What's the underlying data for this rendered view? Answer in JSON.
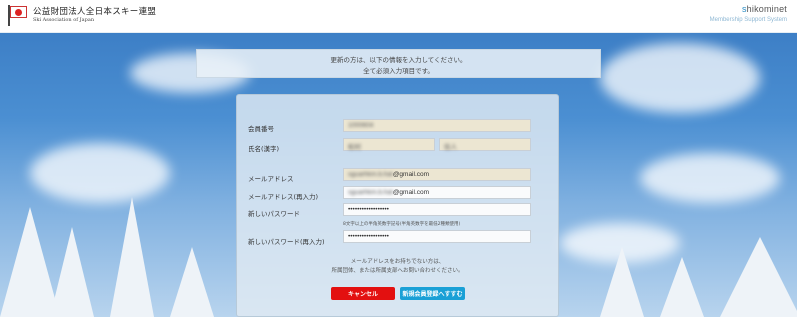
{
  "header": {
    "org_name_jp": "公益財団法人全日本スキー連盟",
    "org_name_en": "Ski Association of Japan",
    "brand_prefix": "s",
    "brand_name": "hikominet",
    "brand_subtitle": "Membership Support System"
  },
  "info": {
    "line1": "更新の方は、以下の情報を入力してください。",
    "line2": "全て必須入力項目です。"
  },
  "form": {
    "member_no_label": "会員番号",
    "member_no_value": "1000604",
    "name_label": "氏名(漢字)",
    "last_name_value": "松村",
    "first_name_value": "信人",
    "email_label": "メールアドレス",
    "email_value_hidden": "sguarhkm.b.hat",
    "email_value_visible": "@gmail.com",
    "email_confirm_label": "メールアドレス(再入力)",
    "email_confirm_value_hidden": "sguarhkm.b.hat",
    "email_confirm_value_visible": "@gmail.com",
    "password_label": "新しいパスワード",
    "password_value": "••••••••••••••••••",
    "password_hint": "8文字以上の半角英数字記号(半角英数字を最低2種類使用)",
    "password_confirm_label": "新しいパスワード(再入力)",
    "password_confirm_value": "••••••••••••••••••"
  },
  "note": {
    "line1": "メールアドレスをお持ちでない方は、",
    "line2": "所属団体、または所属支部へお問い合わせください。"
  },
  "buttons": {
    "cancel": "キャンセル",
    "new_register": "新規会員登録へすすむ"
  },
  "colors": {
    "cancel_bg": "#e31010",
    "new_bg": "#1aa0d6",
    "readonly_field": "#ece6d2"
  }
}
